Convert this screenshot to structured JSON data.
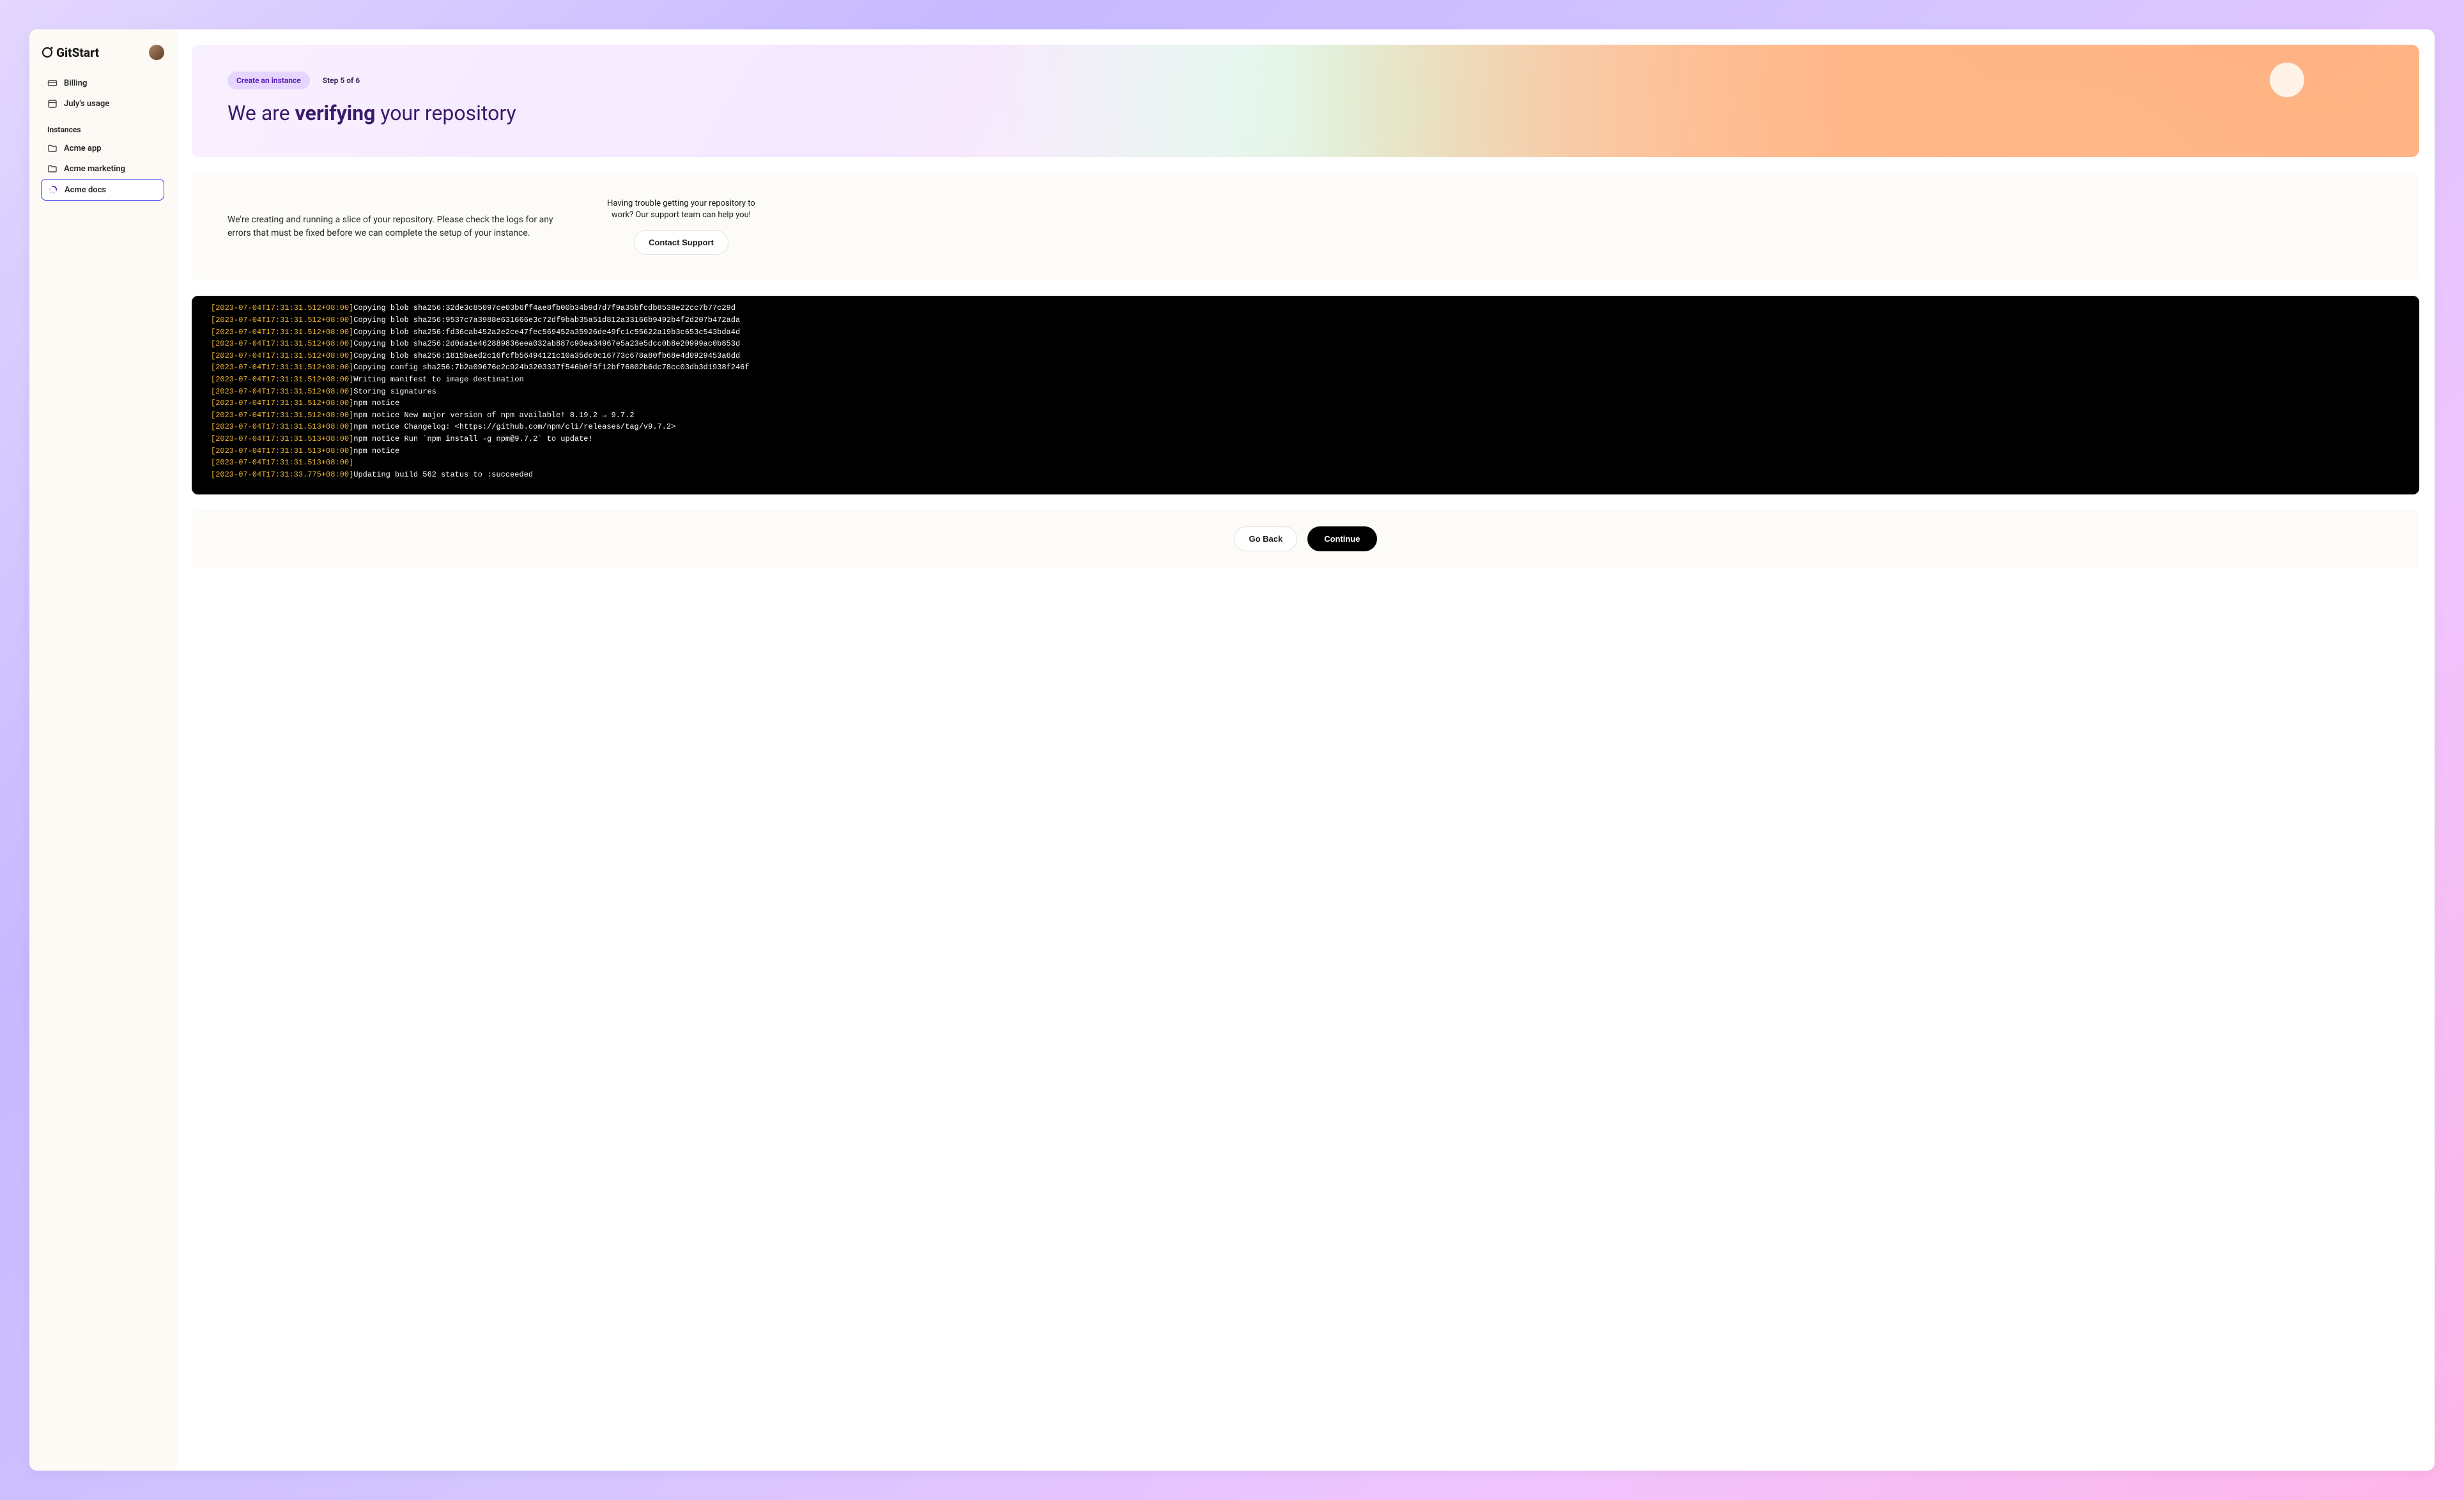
{
  "brand": "GitStart",
  "nav": {
    "billing": "Billing",
    "usage": "July's usage"
  },
  "instances_label": "Instances",
  "instances": [
    {
      "label": "Acme app"
    },
    {
      "label": "Acme marketing"
    },
    {
      "label": "Acme docs"
    }
  ],
  "hero": {
    "badge": "Create an instance",
    "step": "Step 5 of 6",
    "title_pre": "We are ",
    "title_bold": "verifying",
    "title_post": " your repository"
  },
  "info": {
    "text": "We're creating and running a slice of your repository. Please check the logs for any errors that must be fixed before we can complete the setup of your instance.",
    "support_text": "Having trouble getting your repository to work? Our support team can help you!",
    "support_button": "Contact Support"
  },
  "terminal": [
    {
      "ts": "[2023-07-04T17:31:31.512+08:00]",
      "msg": "Copying blob sha256:32de3c85097ce03b6ff4ae8fb00b34b9d7d7f9a35bfcdb8538e22cc7b77c29d"
    },
    {
      "ts": "[2023-07-04T17:31:31.512+08:00]",
      "msg": "Copying blob sha256:9537c7a3988e631666e3c72df9bab35a51d812a33166b9492b4f2d207b472ada"
    },
    {
      "ts": "[2023-07-04T17:31:31.512+08:00]",
      "msg": "Copying blob sha256:fd36cab452a2e2ce47fec569452a35926de49fc1c55622a19b3c653c543bda4d"
    },
    {
      "ts": "[2023-07-04T17:31:31.512+08:00]",
      "msg": "Copying blob sha256:2d0da1e462889836eea032ab887c90ea34967e5a23e5dcc0b8e20999ac0b853d"
    },
    {
      "ts": "[2023-07-04T17:31:31.512+08:00]",
      "msg": "Copying blob sha256:1815baed2c16fcfb56494121c10a35dc0c16773c678a80fb68e4d0929453a6dd"
    },
    {
      "ts": "[2023-07-04T17:31:31.512+08:00]",
      "msg": "Copying config sha256:7b2a09676e2c924b3203337f546b0f5f12bf76802b6dc78cc03db3d1938f246f"
    },
    {
      "ts": "[2023-07-04T17:31:31.512+08:00]",
      "msg": "Writing manifest to image destination"
    },
    {
      "ts": "[2023-07-04T17:31:31.512+08:00]",
      "msg": "Storing signatures"
    },
    {
      "ts": "[2023-07-04T17:31:31.512+08:00]",
      "msg": "npm notice"
    },
    {
      "ts": "[2023-07-04T17:31:31.512+08:00]",
      "msg": "npm notice New major version of npm available! 8.19.2 → 9.7.2"
    },
    {
      "ts": "[2023-07-04T17:31:31.513+08:00]",
      "msg": "npm notice Changelog: <https://github.com/npm/cli/releases/tag/v9.7.2>"
    },
    {
      "ts": "[2023-07-04T17:31:31.513+08:00]",
      "msg": "npm notice Run `npm install -g npm@9.7.2` to update!"
    },
    {
      "ts": "[2023-07-04T17:31:31.513+08:00]",
      "msg": "npm notice"
    },
    {
      "ts": "[2023-07-04T17:31:31.513+08:00]",
      "msg": ""
    },
    {
      "ts": "[2023-07-04T17:31:33.775+08:00]",
      "msg": "Updating build 562 status to :succeeded"
    }
  ],
  "footer": {
    "back": "Go Back",
    "continue": "Continue"
  }
}
